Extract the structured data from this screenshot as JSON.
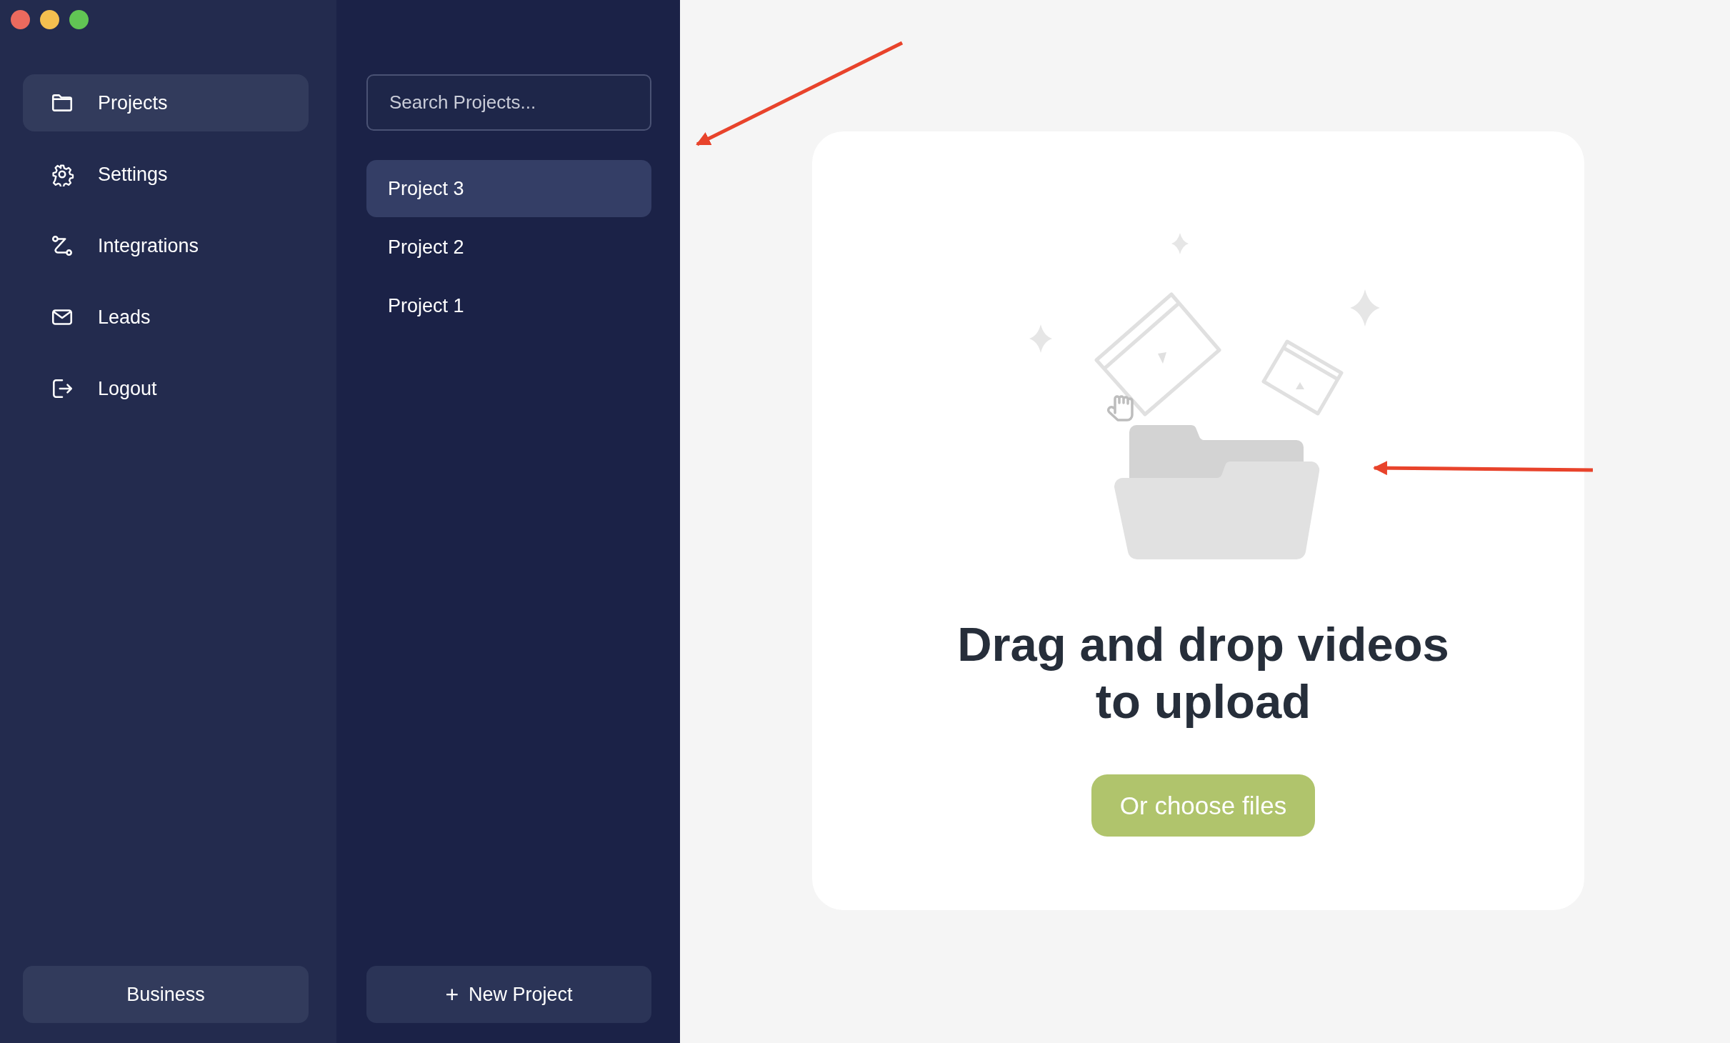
{
  "window": {
    "controls": [
      {
        "color": "#ec6a5e"
      },
      {
        "color": "#f4bf4f"
      },
      {
        "color": "#61c554"
      }
    ]
  },
  "sidebar": {
    "items": [
      {
        "label": "Projects",
        "selected": true
      },
      {
        "label": "Settings",
        "selected": false
      },
      {
        "label": "Integrations",
        "selected": false
      },
      {
        "label": "Leads",
        "selected": false
      },
      {
        "label": "Logout",
        "selected": false
      }
    ],
    "plan_button": "Business"
  },
  "projects": {
    "search": {
      "placeholder": "Search Projects..."
    },
    "items": [
      {
        "label": "Project 3",
        "selected": true
      },
      {
        "label": "Project 2",
        "selected": false
      },
      {
        "label": "Project 1",
        "selected": false
      }
    ],
    "new_button": {
      "icon": "+",
      "label": "New Project"
    }
  },
  "upload": {
    "heading": "Drag and drop videos to upload",
    "button": "Or choose files"
  }
}
